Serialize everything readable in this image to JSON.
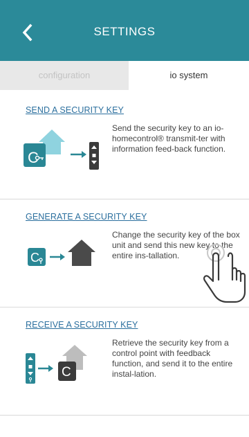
{
  "header": {
    "title": "SETTINGS",
    "back_icon": "chevron-left-icon",
    "background": "#2b8a99"
  },
  "tabs": [
    {
      "label": "configuration",
      "active": false
    },
    {
      "label": "io system",
      "active": true
    }
  ],
  "sections": [
    {
      "title": "SEND A SECURITY KEY",
      "description": "Send the security key to an io-homecontrol® transmit-ter with information feed-back function.",
      "illustration": "box-unit-to-remote"
    },
    {
      "title": "GENERATE A SECURITY KEY",
      "description": "Change the security key of the box unit and send this new key to the entire ins-tallation.",
      "illustration": "box-unit-to-house"
    },
    {
      "title": "RECEIVE A SECURITY KEY",
      "description": "Retrieve the security key from a control point with feedback function, and send it to the entire instal-lation.",
      "illustration": "remote-to-box-unit"
    }
  ],
  "colors": {
    "accent": "#2b8a99",
    "box_unit": "#2a8795",
    "link": "#2b6f9e",
    "house_dark": "#4a4a4a",
    "house_light": "#bdbdbd"
  }
}
